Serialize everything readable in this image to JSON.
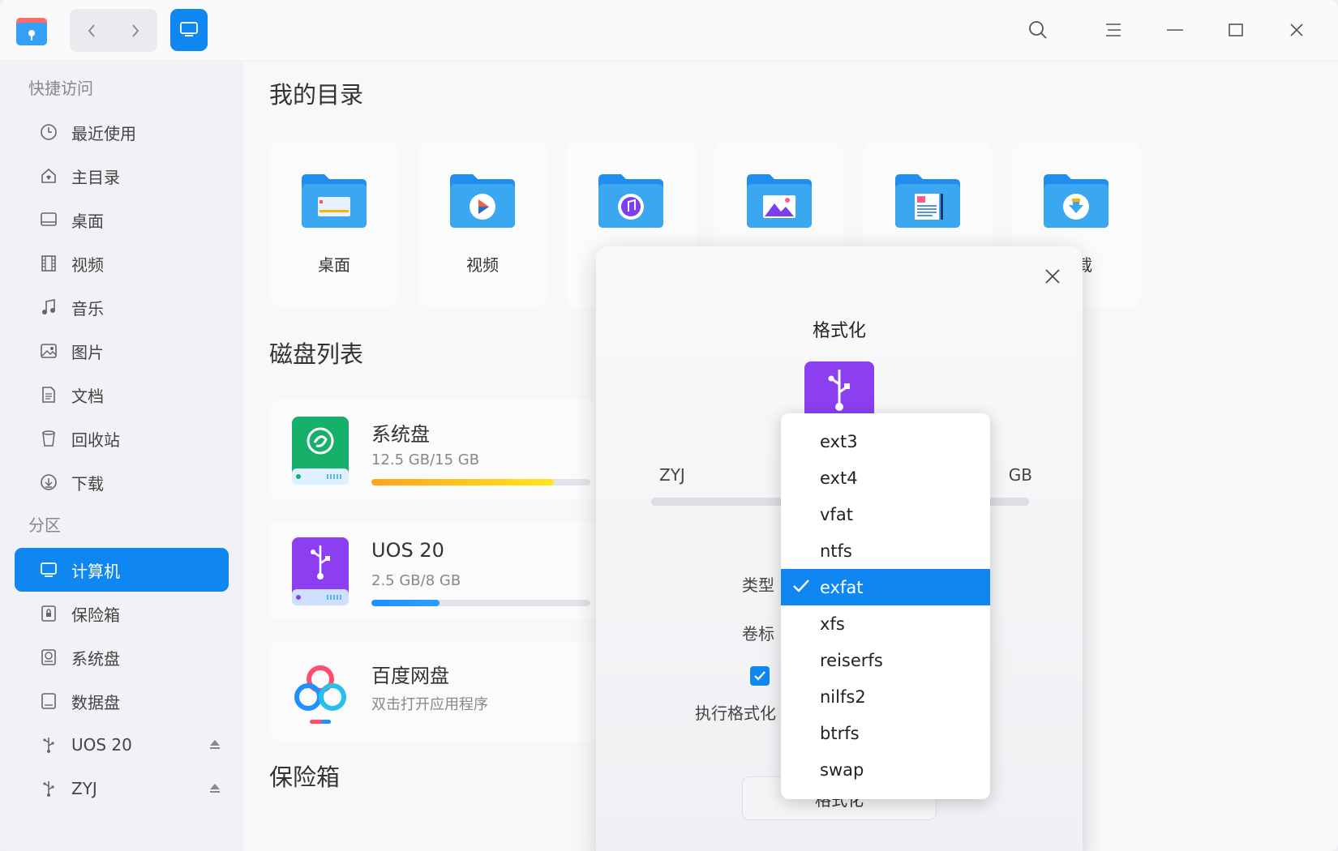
{
  "window": {
    "nav_back": "‹",
    "nav_forward": "›"
  },
  "sidebar": {
    "quick_access_label": "快捷访问",
    "partitions_label": "分区",
    "quick_items": [
      {
        "label": "最近使用",
        "icon": "clock-icon"
      },
      {
        "label": "主目录",
        "icon": "home-icon"
      },
      {
        "label": "桌面",
        "icon": "desktop-icon"
      },
      {
        "label": "视频",
        "icon": "film-icon"
      },
      {
        "label": "音乐",
        "icon": "music-icon"
      },
      {
        "label": "图片",
        "icon": "image-icon"
      },
      {
        "label": "文档",
        "icon": "document-icon"
      },
      {
        "label": "回收站",
        "icon": "trash-icon"
      },
      {
        "label": "下载",
        "icon": "download-icon"
      }
    ],
    "partition_items": [
      {
        "label": "计算机",
        "icon": "computer-icon",
        "active": true
      },
      {
        "label": "保险箱",
        "icon": "vault-icon"
      },
      {
        "label": "系统盘",
        "icon": "system-disk-icon"
      },
      {
        "label": "数据盘",
        "icon": "data-disk-icon"
      },
      {
        "label": "UOS 20",
        "icon": "usb-icon",
        "eject": true
      },
      {
        "label": "ZYJ",
        "icon": "usb-icon",
        "eject": true
      }
    ]
  },
  "main": {
    "my_dirs_title": "我的目录",
    "disks_title": "磁盘列表",
    "vault_title": "保险箱",
    "dirs": [
      {
        "label": "桌面",
        "icon": "desktop-folder-icon"
      },
      {
        "label": "视频",
        "icon": "video-folder-icon"
      },
      {
        "label": "",
        "icon": "music-folder-icon"
      },
      {
        "label": "",
        "icon": "pictures-folder-icon"
      },
      {
        "label": "",
        "icon": "documents-folder-icon"
      },
      {
        "label": "下载",
        "icon": "downloads-folder-icon"
      }
    ],
    "disks": [
      {
        "name": "系统盘",
        "size": "12.5 GB/15 GB",
        "usage": 0.833,
        "color": "#f5a623"
      },
      {
        "name": "UOS 20",
        "size": "2.5 GB/8 GB",
        "usage": 0.3125,
        "color": "#1e90ff"
      },
      {
        "name": "百度网盘",
        "size": "双击打开应用程序"
      }
    ]
  },
  "dialog": {
    "title": "格式化",
    "disk_name": "ZYJ",
    "capacity_partial": "GB",
    "type_label": "类型",
    "volume_label": "卷标",
    "exec_label": "执行格式化",
    "format_button": "格式化"
  },
  "dropdown": {
    "options": [
      "ext3",
      "ext4",
      "vfat",
      "ntfs",
      "exfat",
      "xfs",
      "reiserfs",
      "nilfs2",
      "btrfs",
      "swap"
    ],
    "selected": "exfat"
  },
  "colors": {
    "accent": "#0f86f0",
    "folder_blue": "#3aa7f0",
    "usb_purple": "#8b3ff0",
    "system_green": "#1bb86a"
  }
}
